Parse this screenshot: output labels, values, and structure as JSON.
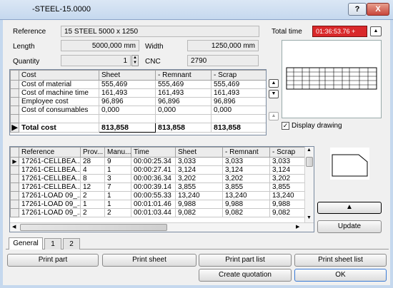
{
  "window": {
    "title": "-STEEL-15.0000",
    "help_label": "?",
    "close_label": "X"
  },
  "fields": {
    "reference_label": "Reference",
    "reference_value": "15  STEEL  5000 x 1250",
    "length_label": "Length",
    "length_value": "5000,000 mm",
    "width_label": "Width",
    "width_value": "1250,000 mm",
    "quantity_label": "Quantity",
    "quantity_value": "1",
    "cnc_label": "CNC",
    "cnc_value": "2790"
  },
  "total_time": {
    "label": "Total time",
    "value": "01:36:53.76 +",
    "color": "#d9282a"
  },
  "cost_table": {
    "headers": [
      "Cost",
      "Sheet",
      "- Remnant",
      "- Scrap"
    ],
    "rows": [
      [
        "Cost of material",
        "555,469",
        "555,469",
        "555,469"
      ],
      [
        "Cost of machine time",
        "161,493",
        "161,493",
        "161,493"
      ],
      [
        "Employee cost",
        "96,896",
        "96,896",
        "96,896"
      ],
      [
        "Cost of consumables",
        "0,000",
        "0,000",
        "0,000"
      ]
    ],
    "total_row": [
      "Total cost",
      "813,858",
      "813,858",
      "813,858"
    ]
  },
  "display_drawing_label": "Display drawing",
  "parts_table": {
    "headers": [
      "Reference",
      "Prov...",
      "Manu...",
      "Time",
      "Sheet",
      "- Remnant",
      "- Scrap"
    ],
    "rows": [
      [
        "17261-CELLBEA...",
        "28",
        "9",
        "00:00:25.34",
        "3,033",
        "3,033",
        "3,033"
      ],
      [
        "17261-CELLBEA...",
        "4",
        "1",
        "00:00:27.41",
        "3,124",
        "3,124",
        "3,124"
      ],
      [
        "17261-CELLBEA...",
        "8",
        "3",
        "00:00:36.34",
        "3,202",
        "3,202",
        "3,202"
      ],
      [
        "17261-CELLBEA...",
        "12",
        "7",
        "00:00:39.14",
        "3,855",
        "3,855",
        "3,855"
      ],
      [
        "17261-LOAD 09_...",
        "2",
        "1",
        "00:00:55.33",
        "13,240",
        "13,240",
        "13,240"
      ],
      [
        "17261-LOAD 09_...",
        "1",
        "1",
        "00:01:01.46",
        "9,988",
        "9,988",
        "9,988"
      ],
      [
        "17261-LOAD 09_...",
        "2",
        "2",
        "00:01:03.44",
        "9,082",
        "9,082",
        "9,082"
      ]
    ]
  },
  "tabs": [
    "General",
    "1",
    "2"
  ],
  "buttons": {
    "update": "Update",
    "print_part": "Print part",
    "print_sheet": "Print sheet",
    "print_part_list": "Print part list",
    "print_sheet_list": "Print sheet list",
    "create_quotation": "Create quotation",
    "ok": "OK"
  }
}
